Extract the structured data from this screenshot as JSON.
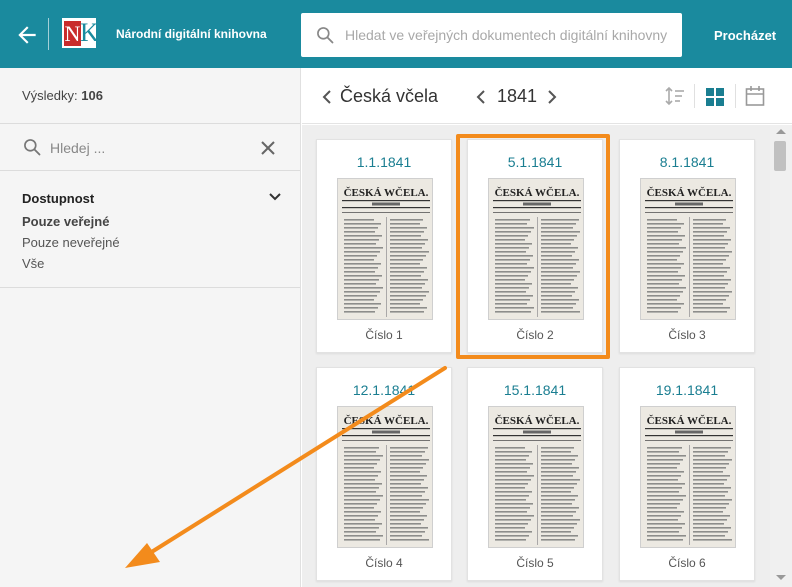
{
  "header": {
    "title": "Národní digitální knihovna",
    "search_placeholder": "Hledat ve veřejných dokumentech digitální knihovny",
    "browse_label": "Procházet"
  },
  "sidebar": {
    "results_label": "Výsledky:",
    "results_count": "106",
    "filter_placeholder": "Hledej ...",
    "facet": {
      "title": "Dostupnost",
      "options": [
        {
          "label": "Pouze veřejné",
          "active": true
        },
        {
          "label": "Pouze neveřejné",
          "active": false
        },
        {
          "label": "Vše",
          "active": false
        }
      ]
    }
  },
  "toolbar": {
    "periodical_title": "Česká včela",
    "year": "1841"
  },
  "issues": [
    {
      "date": "1.1.1841",
      "label": "Číslo 1"
    },
    {
      "date": "5.1.1841",
      "label": "Číslo 2"
    },
    {
      "date": "8.1.1841",
      "label": "Číslo 3"
    },
    {
      "date": "12.1.1841",
      "label": "Číslo 4"
    },
    {
      "date": "15.1.1841",
      "label": "Číslo 5"
    },
    {
      "date": "19.1.1841",
      "label": "Číslo 6"
    }
  ],
  "thumb_masthead": "ČESKÁ WČELA.",
  "colors": {
    "header": "#1a8a9e",
    "accent_text": "#1a7e91",
    "highlight": "#f38b1c"
  }
}
